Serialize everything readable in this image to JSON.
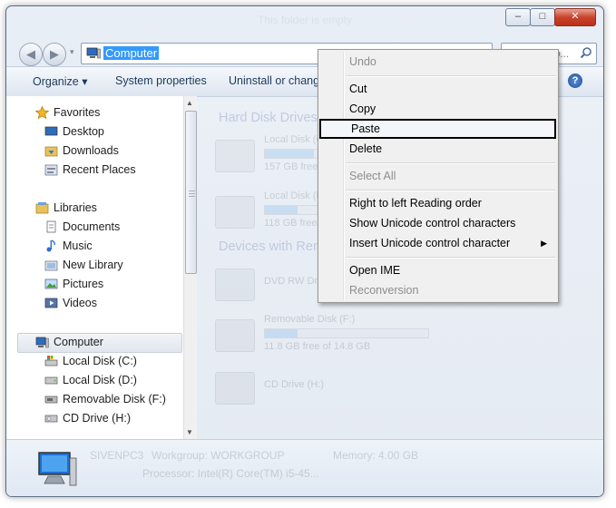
{
  "window": {
    "title": "This folder is empty",
    "caption": {
      "minimize": "–",
      "maximize": "□",
      "close": "✕"
    }
  },
  "nav": {
    "back": "◀",
    "forward": "▶",
    "dropdown": "▾"
  },
  "address": {
    "text": "Computer",
    "refresh": "→"
  },
  "search": {
    "placeholder": "Search Co..."
  },
  "toolbar": {
    "organize": "Organize ▾",
    "system_properties": "System properties",
    "uninstall": "Uninstall or change",
    "help": "?"
  },
  "sidebar": {
    "favorites": "Favorites",
    "desktop": "Desktop",
    "downloads": "Downloads",
    "recent_places": "Recent Places",
    "libraries": "Libraries",
    "documents": "Documents",
    "music": "Music",
    "new_library": "New Library",
    "pictures": "Pictures",
    "videos": "Videos",
    "computer": "Computer",
    "local_c": "Local Disk (C:)",
    "local_d": "Local Disk (D:)",
    "removable_f": "Removable Disk (F:)",
    "cd_h": "CD Drive (H:)"
  },
  "content": {
    "hdd_group": "Hard Disk Drives",
    "devices_group": "Devices with Removable Storage",
    "local_c": "Local Disk (C:)",
    "local_c_free": "157 GB free",
    "local_d": "Local Disk (D:)",
    "local_d_free": "118 GB free",
    "dvd": "DVD RW Drive",
    "removable_f": "Removable Disk (F:)",
    "removable_f_free": "11.8 GB free of 14.8 GB",
    "cd_h": "CD Drive (H:)"
  },
  "details": {
    "computer": "SIVENPC3",
    "workgroup": "Workgroup: WORKGROUP",
    "memory": "Memory: 4.00 GB",
    "processor": "Processor: Intel(R) Core(TM) i5-45..."
  },
  "context_menu": {
    "undo": "Undo",
    "cut": "Cut",
    "copy": "Copy",
    "paste": "Paste",
    "delete": "Delete",
    "select_all": "Select All",
    "rtl": "Right to left Reading order",
    "show_unicode": "Show Unicode control characters",
    "insert_unicode": "Insert Unicode control character",
    "submenu_arrow": "▶",
    "open_ime": "Open IME",
    "reconversion": "Reconversion"
  }
}
